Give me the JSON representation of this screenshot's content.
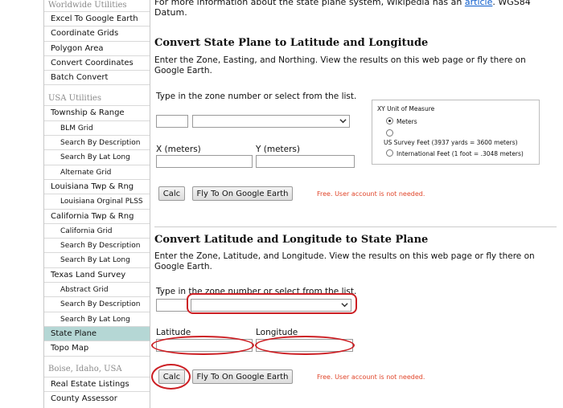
{
  "sidebar": {
    "sections": [
      {
        "header": "Worldwide Utilities",
        "items": [
          {
            "label": "Excel To Google Earth"
          },
          {
            "label": "Coordinate Grids"
          },
          {
            "label": "Polygon Area"
          },
          {
            "label": "Convert Coordinates"
          },
          {
            "label": "Batch Convert"
          }
        ]
      },
      {
        "header": "USA Utilities",
        "items": [
          {
            "label": "Township & Range"
          },
          {
            "label": "BLM Grid",
            "sub": true
          },
          {
            "label": "Search By Description",
            "sub": true
          },
          {
            "label": "Search By Lat Long",
            "sub": true
          },
          {
            "label": "Alternate Grid",
            "sub": true
          },
          {
            "label": "Louisiana Twp & Rng"
          },
          {
            "label": "Louisiana Orginal PLSS",
            "sub": true
          },
          {
            "label": "California Twp & Rng"
          },
          {
            "label": "California Grid",
            "sub": true
          },
          {
            "label": "Search By Description",
            "sub": true
          },
          {
            "label": "Search By Lat Long",
            "sub": true
          },
          {
            "label": "Texas Land Survey"
          },
          {
            "label": "Abstract Grid",
            "sub": true
          },
          {
            "label": "Search By Description",
            "sub": true
          },
          {
            "label": "Search By Lat Long",
            "sub": true
          },
          {
            "label": "State Plane",
            "active": true
          },
          {
            "label": "Topo Map"
          }
        ]
      },
      {
        "header": "Boise, Idaho, USA",
        "items": [
          {
            "label": "Real Estate Listings"
          },
          {
            "label": "County Assessor"
          }
        ]
      }
    ]
  },
  "intro": {
    "text_before": "For more information about the state plane system, Wikipedia has an ",
    "link": "article",
    "text_after": ".  WGS84 Datum."
  },
  "section1": {
    "title": "Convert State Plane to Latitude and Longitude",
    "description": "Enter the Zone, Easting, and Northing.  View the results on this web page or fly there on Google Earth.",
    "zone_label": "Type in the zone number or select from the list.",
    "zone_value": "",
    "zone_select_value": "",
    "x_label": "X (meters)",
    "y_label": "Y (meters)",
    "x_value": "",
    "y_value": "",
    "calc_label": "Calc",
    "fly_label": "Fly To On Google Earth",
    "free_note": "Free. User account is not needed.",
    "unit_box": {
      "title": "XY Unit of Measure",
      "options": [
        {
          "label": "Meters",
          "selected": true
        },
        {
          "label": "US Survey Feet (3937 yards = 3600 meters)",
          "selected": false
        },
        {
          "label": "International Feet (1 foot = .3048 meters)",
          "selected": false
        }
      ]
    }
  },
  "section2": {
    "title": "Convert Latitude and Longitude to State Plane",
    "description": "Enter the Zone, Latitude, and Longitude.  View the results on this web page or fly there on Google Earth.",
    "zone_label": "Type in the zone number or select from the list.",
    "zone_value": "",
    "zone_select_value": "",
    "lat_label": "Latitude",
    "lon_label": "Longitude",
    "lat_value": "",
    "lon_value": "",
    "calc_label": "Calc",
    "fly_label": "Fly To On Google Earth",
    "free_note": "Free. User account is not needed."
  },
  "colors": {
    "highlight_ring": "#cc1f24",
    "active_nav": "#b5d7d5",
    "link": "#0b5ccc",
    "note": "#e0452a"
  }
}
